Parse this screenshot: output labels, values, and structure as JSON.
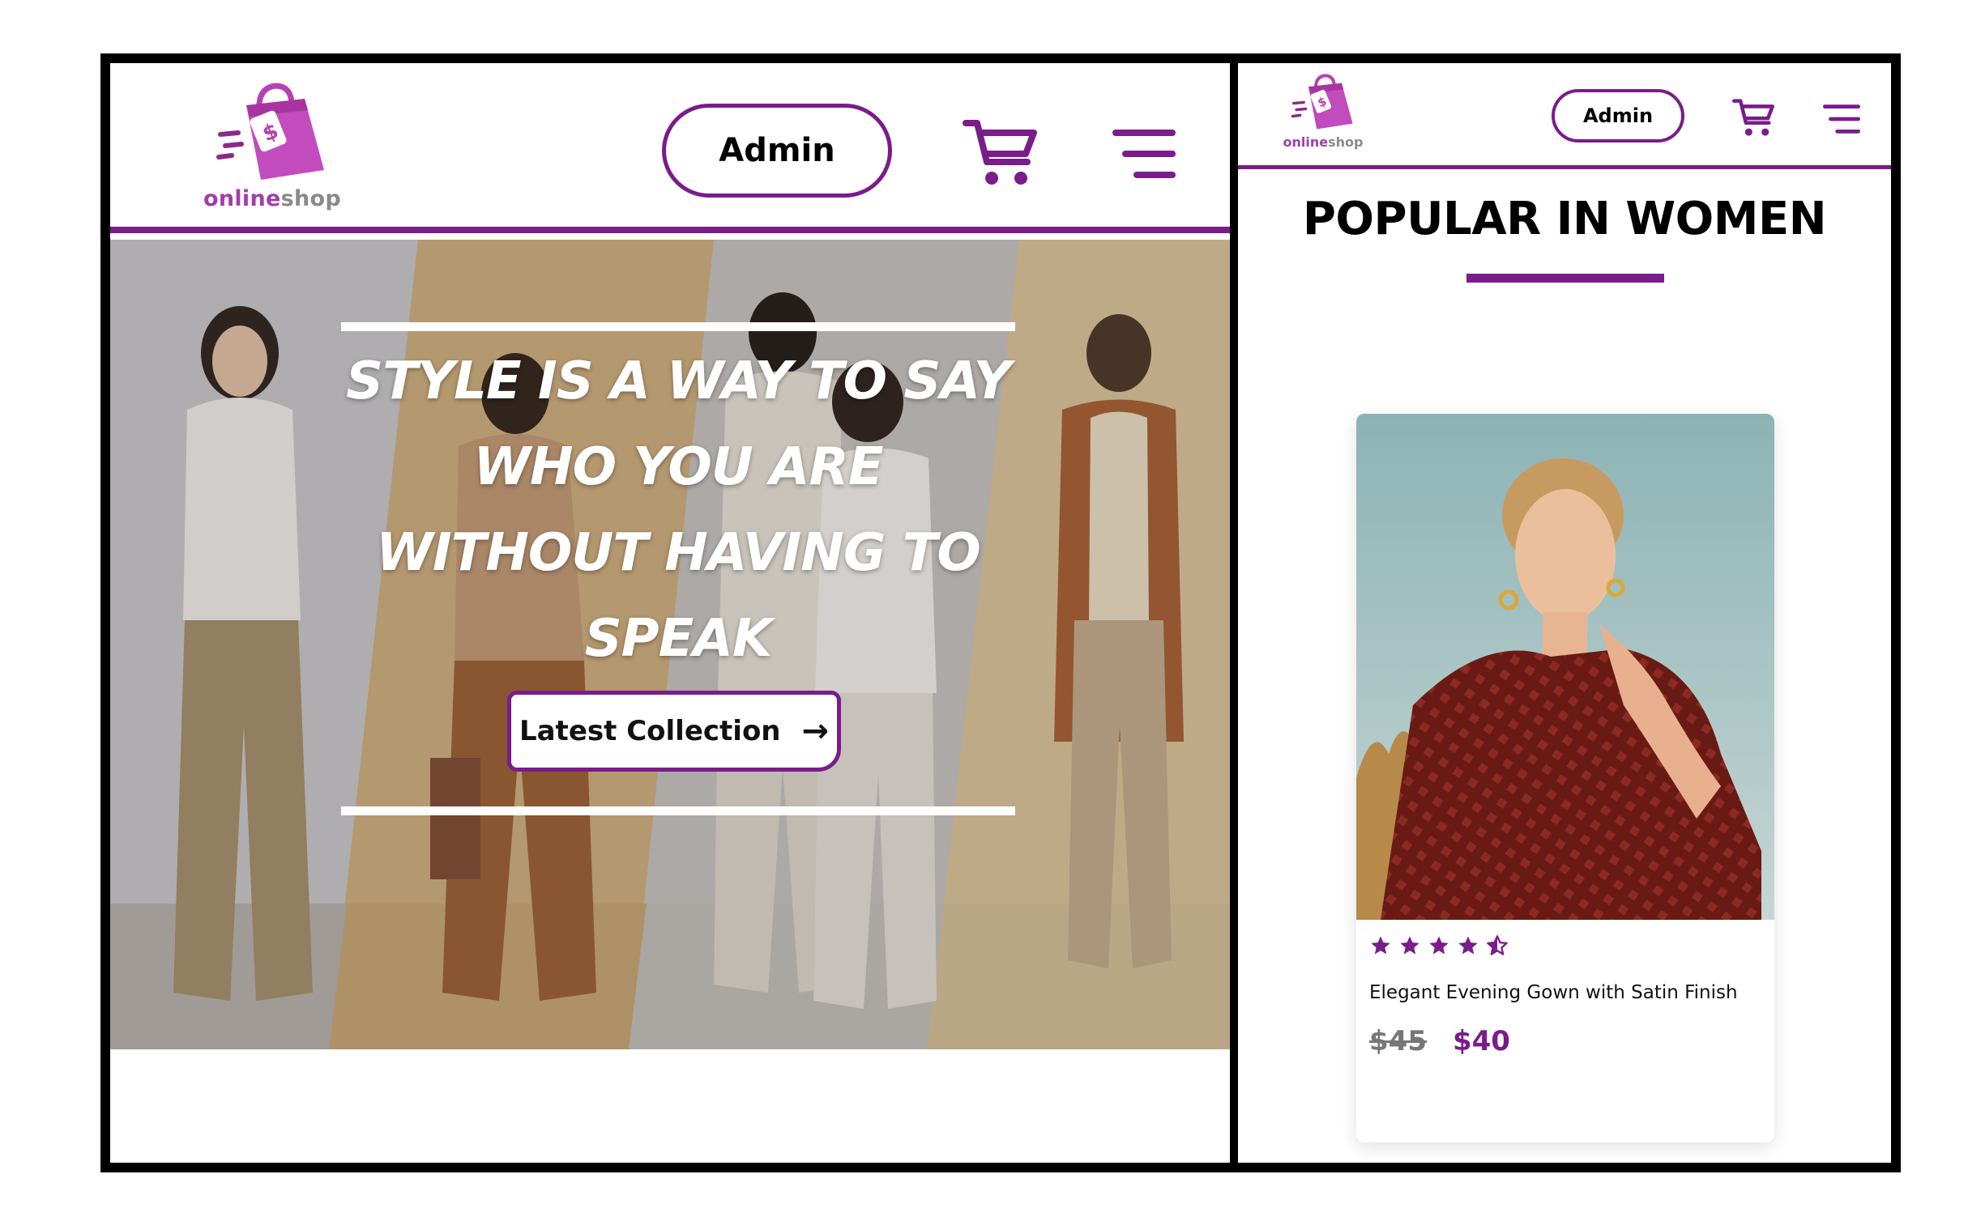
{
  "brand": {
    "logo_text_1": "online",
    "logo_text_2": "shop",
    "logo_icon": "shopping-bag-icon",
    "accent_color": "#7a1c8a"
  },
  "desktop": {
    "header": {
      "admin_label": "Admin",
      "cart_icon": "cart-icon",
      "menu_icon": "menu-icon"
    },
    "hero": {
      "title_lines": [
        "STYLE IS A WAY TO SAY",
        "WHO YOU ARE",
        "WITHOUT HAVING TO",
        "SPEAK"
      ],
      "cta_label": "Latest Collection",
      "cta_icon": "arrow-right-icon"
    }
  },
  "mobile": {
    "header": {
      "admin_label": "Admin",
      "cart_icon": "cart-icon",
      "menu_icon": "menu-icon"
    },
    "section_title": "POPULAR IN WOMEN",
    "product": {
      "name": "Elegant Evening Gown with Satin Finish",
      "rating": 4.5,
      "old_price": "$45",
      "new_price": "$40"
    }
  }
}
